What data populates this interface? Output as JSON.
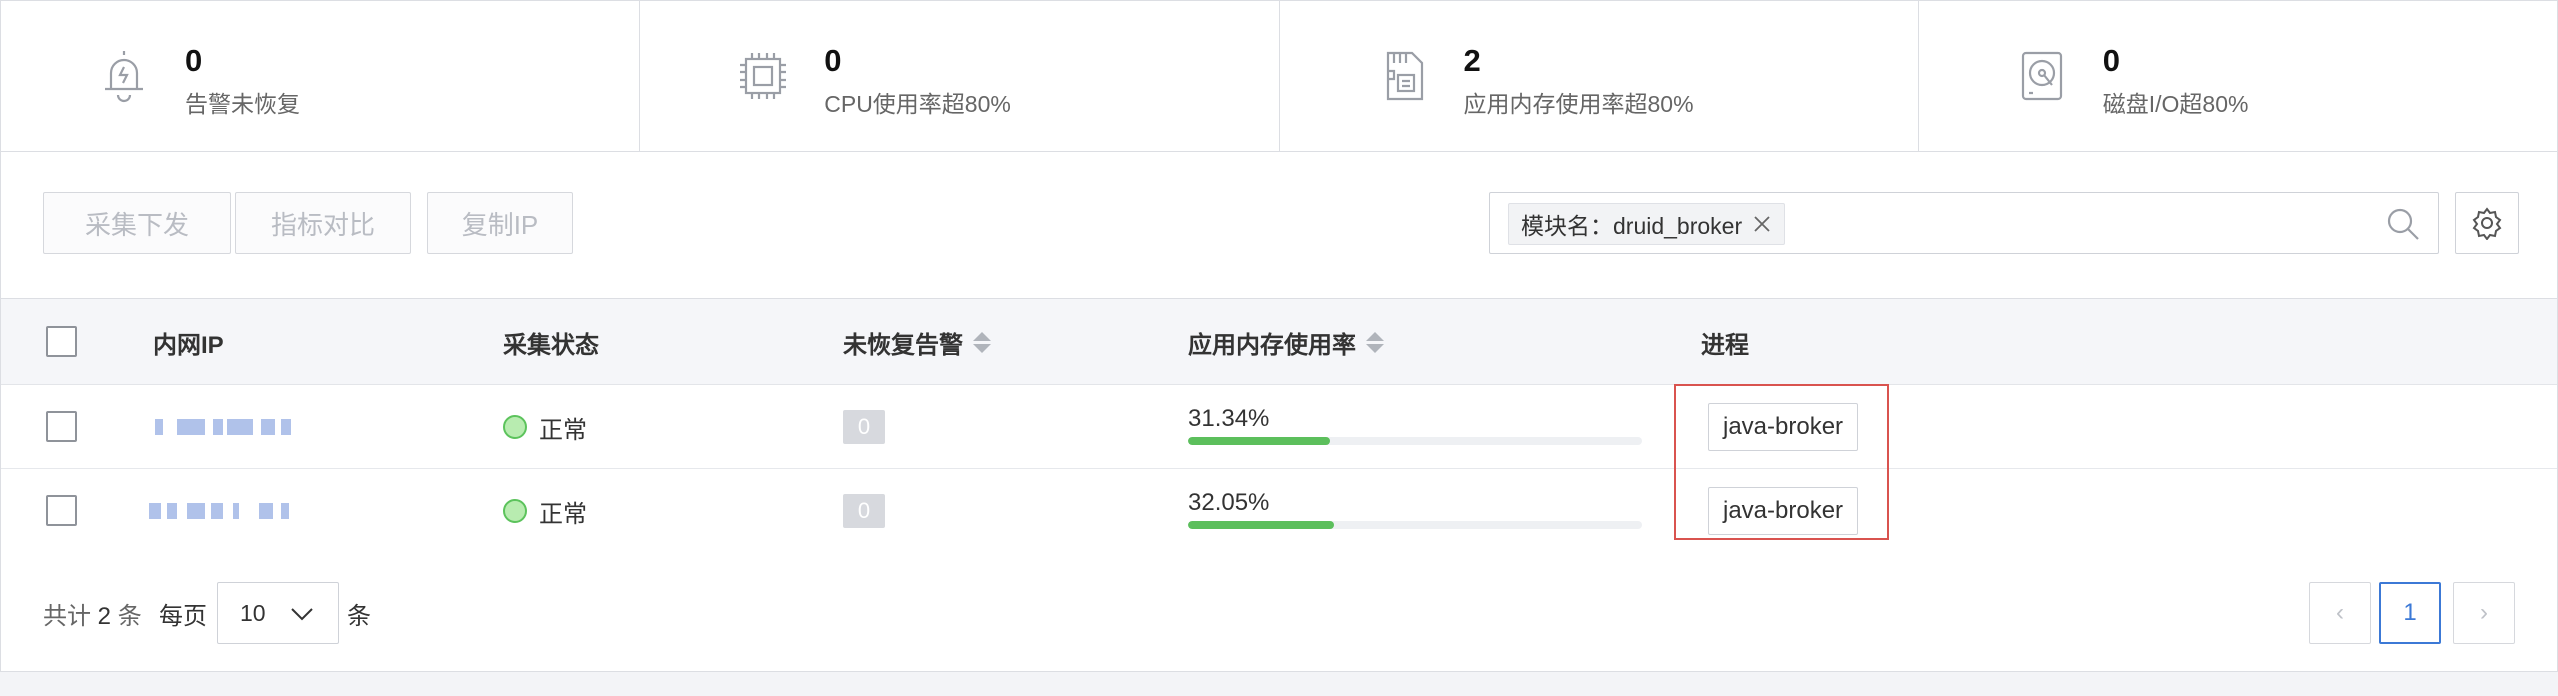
{
  "stats": [
    {
      "icon": "bell-alert-icon",
      "value": "0",
      "label": "告警未恢复"
    },
    {
      "icon": "cpu-chip-icon",
      "value": "0",
      "label": "CPU使用率超80%"
    },
    {
      "icon": "memory-card-icon",
      "value": "2",
      "label": "应用内存使用率超80%"
    },
    {
      "icon": "disk-drive-icon",
      "value": "0",
      "label": "磁盘I/O超80%"
    }
  ],
  "toolbar": {
    "collect_label": "采集下发",
    "compare_label": "指标对比",
    "copy_ip_label": "复制IP",
    "filter_tag": "模块名：druid_broker"
  },
  "table": {
    "headers": {
      "ip": "内网IP",
      "status": "采集状态",
      "alerts": "未恢复告警",
      "memory": "应用内存使用率",
      "process": "进程"
    },
    "rows": [
      {
        "status": "正常",
        "alerts": "0",
        "memory_pct": "31.34%",
        "memory_value": 31.34,
        "process": "java-broker"
      },
      {
        "status": "正常",
        "alerts": "0",
        "memory_pct": "32.05%",
        "memory_value": 32.05,
        "process": "java-broker"
      }
    ]
  },
  "pagination": {
    "total_prefix": "共计",
    "total_count": "2",
    "total_suffix": "条",
    "per_page_label": "每页",
    "per_page_value": "10",
    "per_page_unit": "条",
    "current_page": "1",
    "prev_icon": "‹",
    "next_icon": "›"
  },
  "colors": {
    "progress": "#5cbf5c",
    "status_ok": "#5cc35c",
    "highlight": "#d9534f",
    "active_page": "#3c79d6"
  }
}
